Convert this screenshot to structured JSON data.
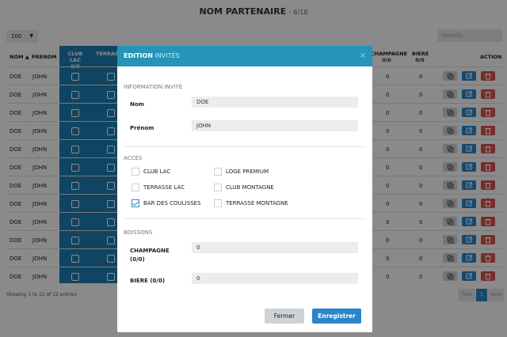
{
  "page": {
    "title": "NOM PARTENAIRE",
    "subtitle": "- 6/18",
    "page_size": "100",
    "search_placeholder": "Search..."
  },
  "table": {
    "headers": {
      "nom": "NOM",
      "prenom": "PRENOM",
      "club_lac": "CLUB LAC",
      "club_lac_count": "0/0",
      "terrasse": "TERRASS",
      "champagne": "CHAMPAGNE",
      "champagne_count": "0/0",
      "biere": "BIERE",
      "biere_count": "0/0",
      "action": "ACTION"
    },
    "rows": [
      {
        "nom": "DOE",
        "prenom": "JOHN",
        "champagne": "0",
        "biere": "0"
      },
      {
        "nom": "DOE",
        "prenom": "JOHN",
        "champagne": "0",
        "biere": "0"
      },
      {
        "nom": "DOE",
        "prenom": "JOHN",
        "champagne": "0",
        "biere": "0"
      },
      {
        "nom": "DOE",
        "prenom": "JOHN",
        "champagne": "0",
        "biere": "0"
      },
      {
        "nom": "DOE",
        "prenom": "JOHN",
        "champagne": "0",
        "biere": "0"
      },
      {
        "nom": "DOE",
        "prenom": "JOHN",
        "champagne": "0",
        "biere": "0"
      },
      {
        "nom": "DOE",
        "prenom": "JOHN",
        "champagne": "0",
        "biere": "0"
      },
      {
        "nom": "DOE",
        "prenom": "JOHN",
        "champagne": "0",
        "biere": "0"
      },
      {
        "nom": "DOE",
        "prenom": "JOHN",
        "champagne": "0",
        "biere": "0"
      },
      {
        "nom": "DOE",
        "prenom": "JOHN",
        "champagne": "0",
        "biere": "0"
      },
      {
        "nom": "DOE",
        "prenom": "JOHN",
        "champagne": "0",
        "biere": "0"
      },
      {
        "nom": "DOE",
        "prenom": "JOHN",
        "champagne": "0",
        "biere": "0"
      }
    ],
    "info": "Showing 1 to 12 of 12 entries",
    "pager": {
      "prev": "Prev",
      "current": "1",
      "next": "Next"
    }
  },
  "icons": {
    "copy": "copy-icon",
    "edit": "edit-icon",
    "delete": "trash-icon",
    "sort": "sort-up-icon"
  },
  "colors": {
    "accent": "#2494b8",
    "column_blue": "#1d7fb3",
    "danger": "#d9534f"
  },
  "modal": {
    "title_bold": "EDITION",
    "title_rest": "INVITÉS",
    "section_info": "INFORMATION INVITÉ",
    "nom_label": "Nom",
    "nom_value": "DOE",
    "prenom_label": "Prénom",
    "prenom_value": "JOHN",
    "section_acces": "ACCÈS",
    "access": [
      {
        "label": "CLUB LAC",
        "checked": false
      },
      {
        "label": "LOGE PREMIUM",
        "checked": false
      },
      {
        "label": "TERRASSE LAC",
        "checked": false
      },
      {
        "label": "CLUB MONTAGNE",
        "checked": false
      },
      {
        "label": "BAR DES COULISSES",
        "checked": true
      },
      {
        "label": "TERRASSE MONTAGNE",
        "checked": false
      }
    ],
    "section_boissons": "BOISSONS",
    "champagne_label_1": "CHAMPAGNE",
    "champagne_label_2": "(0/0)",
    "champagne_value": "0",
    "biere_label": "BIERE (0/0)",
    "biere_value": "0",
    "btn_close": "Fermer",
    "btn_save": "Enregistrer"
  }
}
